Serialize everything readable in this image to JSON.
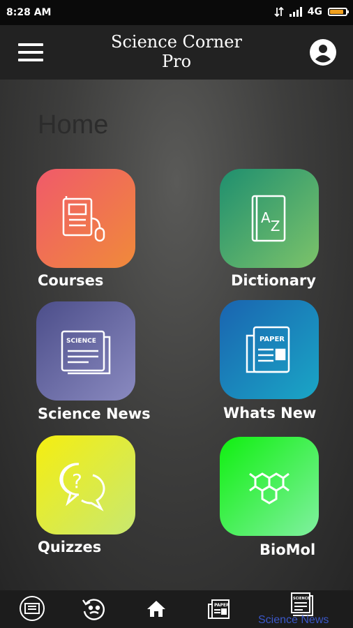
{
  "status_bar": {
    "time": "8:28 AM",
    "network": "4G"
  },
  "app_bar": {
    "title": "Science Corner Pro"
  },
  "page": {
    "title": "Home"
  },
  "tiles": [
    {
      "label": "Courses"
    },
    {
      "label": "Dictionary"
    },
    {
      "label": "Science News",
      "icon_text": "SCIENCE"
    },
    {
      "label": "Whats New",
      "icon_text": "PAPER"
    },
    {
      "label": "Quizzes"
    },
    {
      "label": "BioMol"
    }
  ],
  "dictionary_icon_text": "AZ",
  "bottom_nav": {
    "items": [
      "courses-icon",
      "quiz-icon",
      "home-icon",
      "paper-icon",
      "science-news-icon"
    ],
    "active_label": "Science News",
    "active_color": "#3b57c8",
    "news_icon_text": "SCIENCE",
    "paper_icon_text": "PAPER"
  }
}
